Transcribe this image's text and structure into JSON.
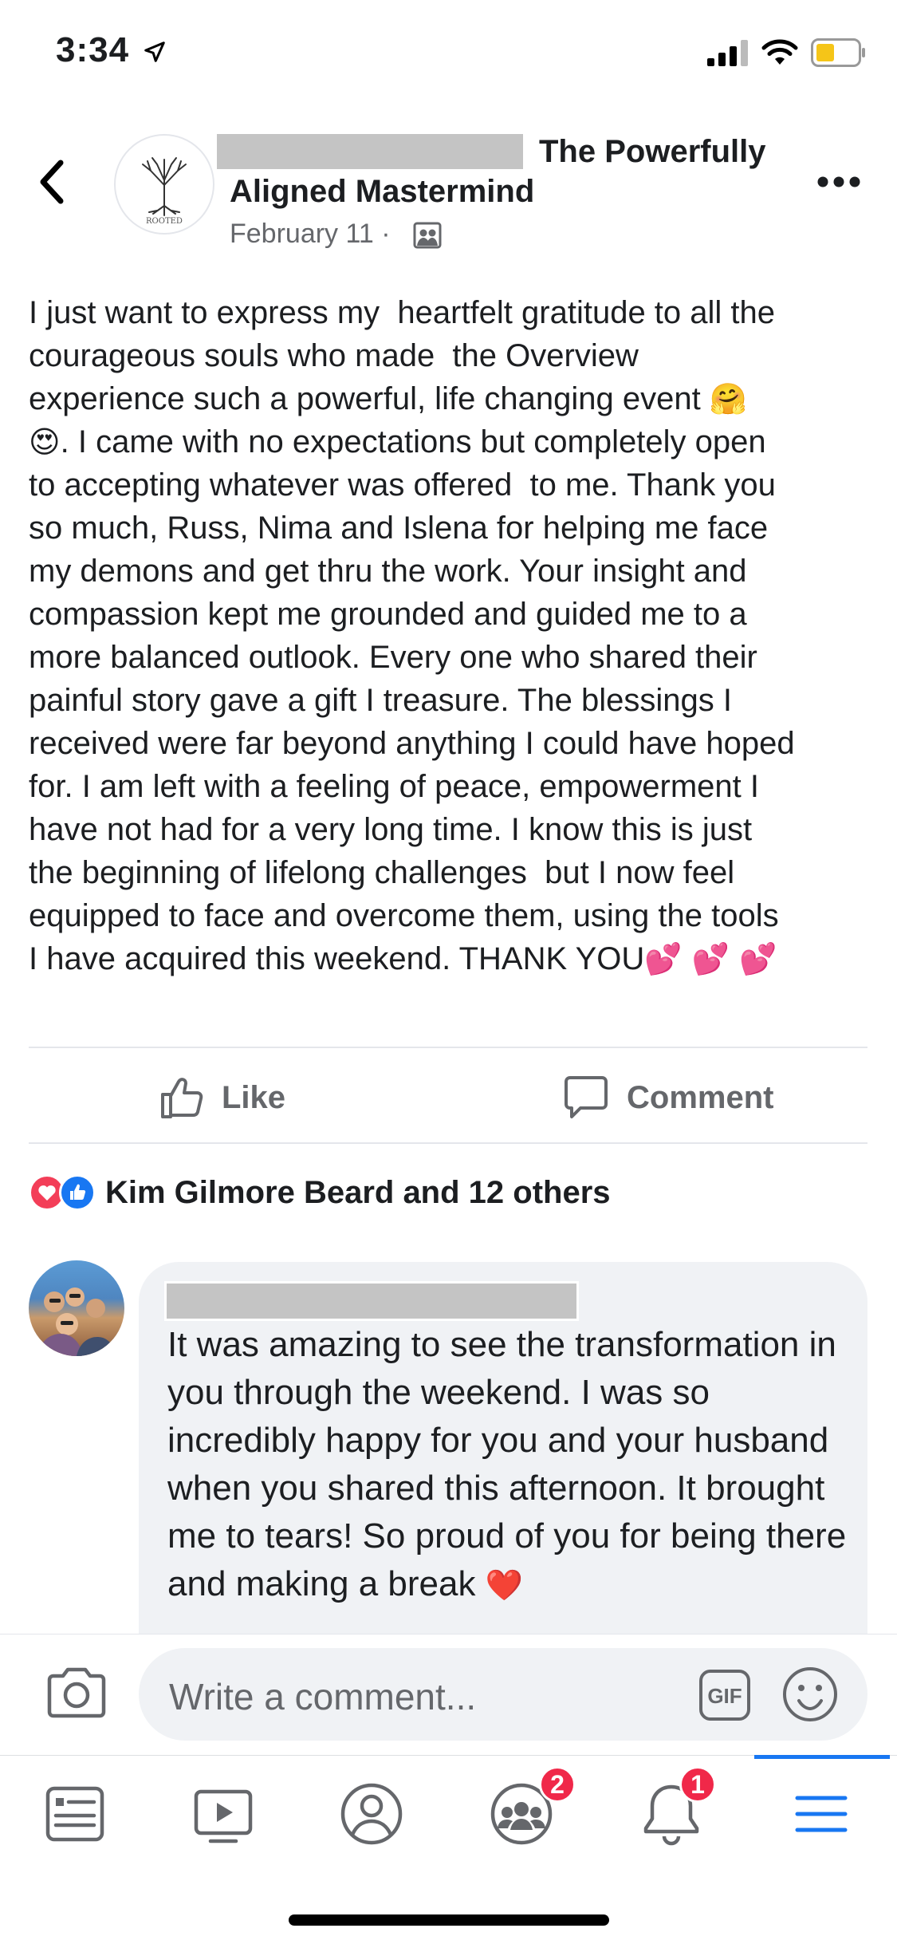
{
  "status_bar": {
    "time": "3:34",
    "location_icon": "location-arrow-icon",
    "signal_icon": "cellular-signal-icon",
    "wifi_icon": "wifi-icon",
    "battery_icon": "battery-icon",
    "battery_color": "#f5c518"
  },
  "post": {
    "group_name_line1": "The Powerfully",
    "group_name_line2": "Aligned Mastermind",
    "group_logo_text": "ROOTED",
    "date": "February 11 ·",
    "audience_icon": "group-audience-icon",
    "text_part1": "I just want to express my  heartfelt gratitude to all the\ncourageous souls who made  the Overview\nexperience such a powerful, life changing event ",
    "emoji_hug": "🤗",
    "emoji_hearteyes": "😍",
    "text_part2": ". I came with no expectations but completely open\nto accepting whatever was offered  to me. Thank you\nso much, Russ, Nima and Islena for helping me face\nmy demons and get thru the work. Your insight and\ncompassion kept me grounded and guided me to a\nmore balanced outlook. Every one who shared their\npainful story gave a gift I treasure. The blessings I\nreceived were far beyond anything I could have hoped\nfor. I am left with a feeling of peace, empowerment I\nhave not had for a very long time. I know this is just\nthe beginning of lifelong challenges  but I now feel\nequipped to face and overcome them, using the tools\nI have acquired this weekend. THANK YOU",
    "emoji_hearts": "💕 💕 💕"
  },
  "actions": {
    "like_label": "Like",
    "comment_label": "Comment"
  },
  "reactions": {
    "summary": "Kim Gilmore Beard and 12 others",
    "love_color": "#f33e58",
    "like_color": "#1877f2"
  },
  "comment": {
    "text": "It was amazing to see the transformation in you through the weekend. I was so incredibly happy for you and your husband when you shared this afternoon. It brought me to tears! So proud of you for being there and making a break",
    "heart_emoji": "❤️"
  },
  "composer": {
    "placeholder": "Write a comment...",
    "gif_label": "GIF"
  },
  "tab_bar": {
    "groups_badge": "2",
    "notifications_badge": "1",
    "active_color": "#1877f2"
  }
}
